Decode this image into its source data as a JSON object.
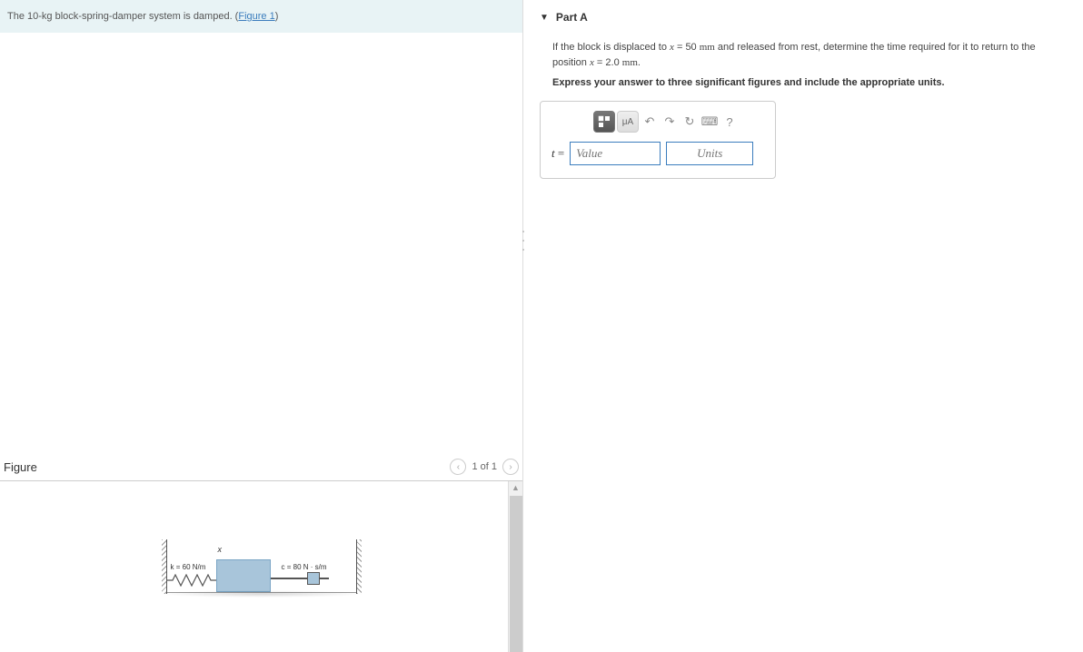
{
  "problem": {
    "mass": "10-kg",
    "text_prefix": "The ",
    "text_mid": " block-spring-damper system is damped. (",
    "figure_link": "Figure 1",
    "text_suffix": ")"
  },
  "figure": {
    "title": "Figure",
    "pager": "1 of 1",
    "k_label": "k = 60 N/m",
    "c_label": "c = 80 N · s/m",
    "x_label": "x"
  },
  "part": {
    "label": "Part A",
    "question_prefix": "If the block is displaced to ",
    "var1": "x",
    "eq1": " = 50 ",
    "unit1": "mm",
    "question_mid": " and released from rest, determine the time required for it to return to the position ",
    "var2": "x",
    "eq2": " = 2.0 ",
    "unit2": "mm",
    "question_suffix": ".",
    "instruction": "Express your answer to three significant figures and include the appropriate units."
  },
  "answer": {
    "variable": "t",
    "equals": " =",
    "value_placeholder": "Value",
    "units_placeholder": "Units",
    "toolbar": {
      "templates": "▭",
      "mu": "μA",
      "undo": "↶",
      "redo": "↷",
      "reset": "↻",
      "keyboard": "⌨",
      "help": "?"
    }
  }
}
